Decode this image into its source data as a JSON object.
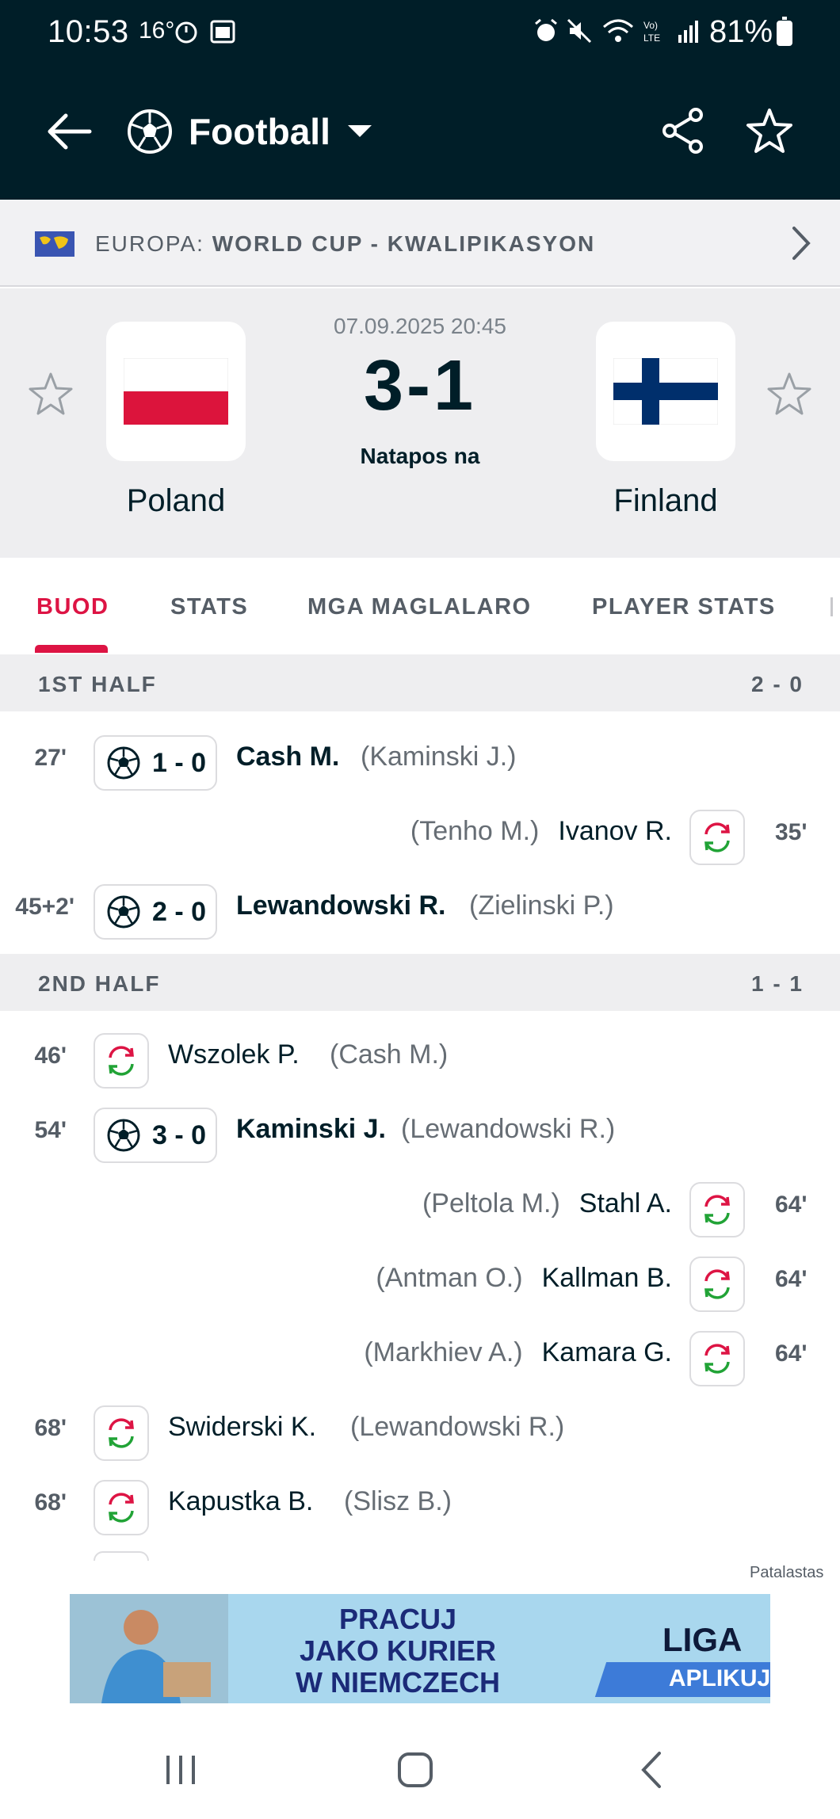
{
  "status_bar": {
    "time": "10:53",
    "temperature": "16°",
    "battery": "81%"
  },
  "header": {
    "sport": "Football",
    "icons": [
      "back-arrow-icon",
      "football-icon",
      "dropdown-caret-icon",
      "share-icon",
      "star-icon"
    ]
  },
  "competition": {
    "region": "EUROPA:",
    "name": "WORLD CUP - KWALIPIKASYON"
  },
  "match": {
    "datetime": "07.09.2025 20:45",
    "score": "3-1",
    "status": "Natapos na",
    "home": {
      "name": "Poland"
    },
    "away": {
      "name": "Finland"
    }
  },
  "tabs": [
    {
      "label": "BUOD",
      "active": true
    },
    {
      "label": "STATS"
    },
    {
      "label": "MGA MAGLALARO"
    },
    {
      "label": "PLAYER STATS"
    }
  ],
  "halves": [
    {
      "label": "1ST HALF",
      "score": "2 - 0",
      "events": [
        {
          "minute": "27'",
          "side": "home",
          "type": "goal",
          "score": "1 - 0",
          "player": "Cash M.",
          "assist": "(Kaminski J.)"
        },
        {
          "minute": "35'",
          "side": "away",
          "type": "sub",
          "player": "Ivanov R.",
          "assist": "(Tenho M.)"
        },
        {
          "minute": "45+2'",
          "side": "home",
          "type": "goal",
          "score": "2 - 0",
          "player": "Lewandowski R.",
          "assist": "(Zielinski P.)"
        }
      ]
    },
    {
      "label": "2ND HALF",
      "score": "1 - 1",
      "events": [
        {
          "minute": "46'",
          "side": "home",
          "type": "sub",
          "player": "Wszolek P.",
          "assist": "(Cash M.)"
        },
        {
          "minute": "54'",
          "side": "home",
          "type": "goal",
          "score": "3 - 0",
          "player": "Kaminski J.",
          "assist": "(Lewandowski R.)"
        },
        {
          "minute": "64'",
          "side": "away",
          "type": "sub",
          "player": "Stahl A.",
          "assist": "(Peltola M.)"
        },
        {
          "minute": "64'",
          "side": "away",
          "type": "sub",
          "player": "Kallman B.",
          "assist": "(Antman O.)"
        },
        {
          "minute": "64'",
          "side": "away",
          "type": "sub",
          "player": "Kamara G.",
          "assist": "(Markhiev A.)"
        },
        {
          "minute": "68'",
          "side": "home",
          "type": "sub",
          "player": "Swiderski K.",
          "assist": "(Lewandowski R.)"
        },
        {
          "minute": "68'",
          "side": "home",
          "type": "sub",
          "player": "Kapustka B.",
          "assist": "(Slisz B.)"
        }
      ]
    }
  ],
  "ad": {
    "label": "Patalastas",
    "line1": "PRACUJ",
    "line2": "JAKO KURIER",
    "line3": "W NIEMCZECH",
    "brand": "LIGA",
    "cta": "APLIKUJ"
  },
  "colors": {
    "header_bg": "#001e28",
    "accent": "#dd1444",
    "poland_red": "#dc143c",
    "finland_blue": "#002f6c"
  }
}
